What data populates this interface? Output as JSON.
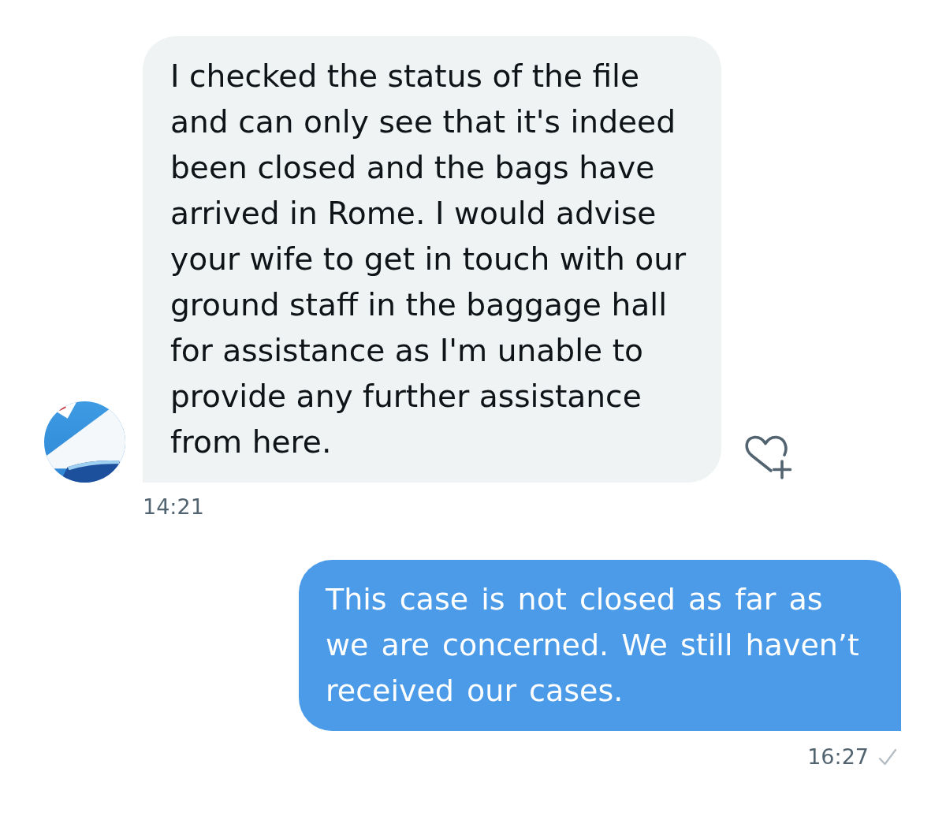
{
  "messages": [
    {
      "kind": "received",
      "text": "I checked the status of the file and can only see that it's indeed been closed and the bags have arrived in Rome. I would advise your wife to get in touch with our ground staff in the baggage hall for assistance as I'm unable to provide any further assistance from here.",
      "time": "14:21"
    },
    {
      "kind": "sent",
      "text": "This case is not closed as far as we are concerned. We still haven’t received our cases.",
      "time": "16:27"
    }
  ]
}
